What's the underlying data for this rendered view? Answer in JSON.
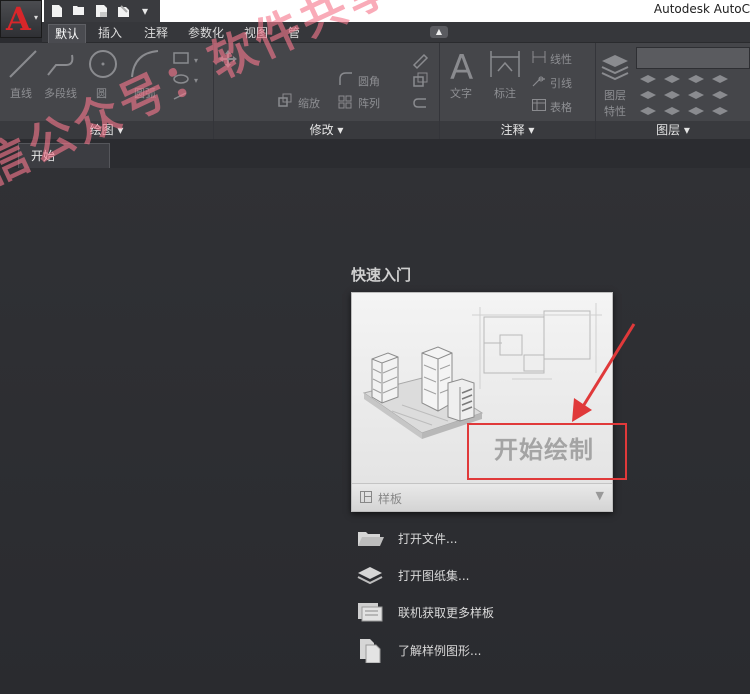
{
  "app": {
    "title": "Autodesk AutoC",
    "logo_letter": "A",
    "accent": "#d8262a"
  },
  "ribbon_tabs": [
    "默认",
    "插入",
    "注释",
    "参数化",
    "视图",
    "管"
  ],
  "ribbon": {
    "draw_panel": {
      "title": "绘图 ▾",
      "tools": [
        "直线",
        "多段线",
        "圆",
        "圆弧"
      ]
    },
    "modify_panel": {
      "title": "修改 ▾",
      "tools": [
        "圆角",
        "缩放",
        "阵列"
      ]
    },
    "annotation_panel": {
      "title": "注释 ▾",
      "tools": [
        "文字",
        "标注",
        "线性",
        "引线",
        "表格"
      ]
    },
    "layers_panel": {
      "title": "图层 ▾",
      "tools": [
        "图层",
        "特性"
      ]
    }
  },
  "doc_tab": {
    "label": "开始"
  },
  "quick_start": {
    "heading": "快速入门",
    "card_label": "开始绘制",
    "template_label": "样板",
    "template_caret": "▼"
  },
  "links": [
    {
      "icon": "folder-open-icon",
      "label": "打开文件..."
    },
    {
      "icon": "sheet-set-icon",
      "label": "打开图纸集..."
    },
    {
      "icon": "online-templates-icon",
      "label": "联机获取更多样板"
    },
    {
      "icon": "sample-drawings-icon",
      "label": "了解样例图形..."
    }
  ],
  "watermark": "信公众号：软件共享",
  "colors": {
    "highlight": "#e0393a",
    "background": "#2b2c30",
    "ribbon": "#45464a"
  }
}
